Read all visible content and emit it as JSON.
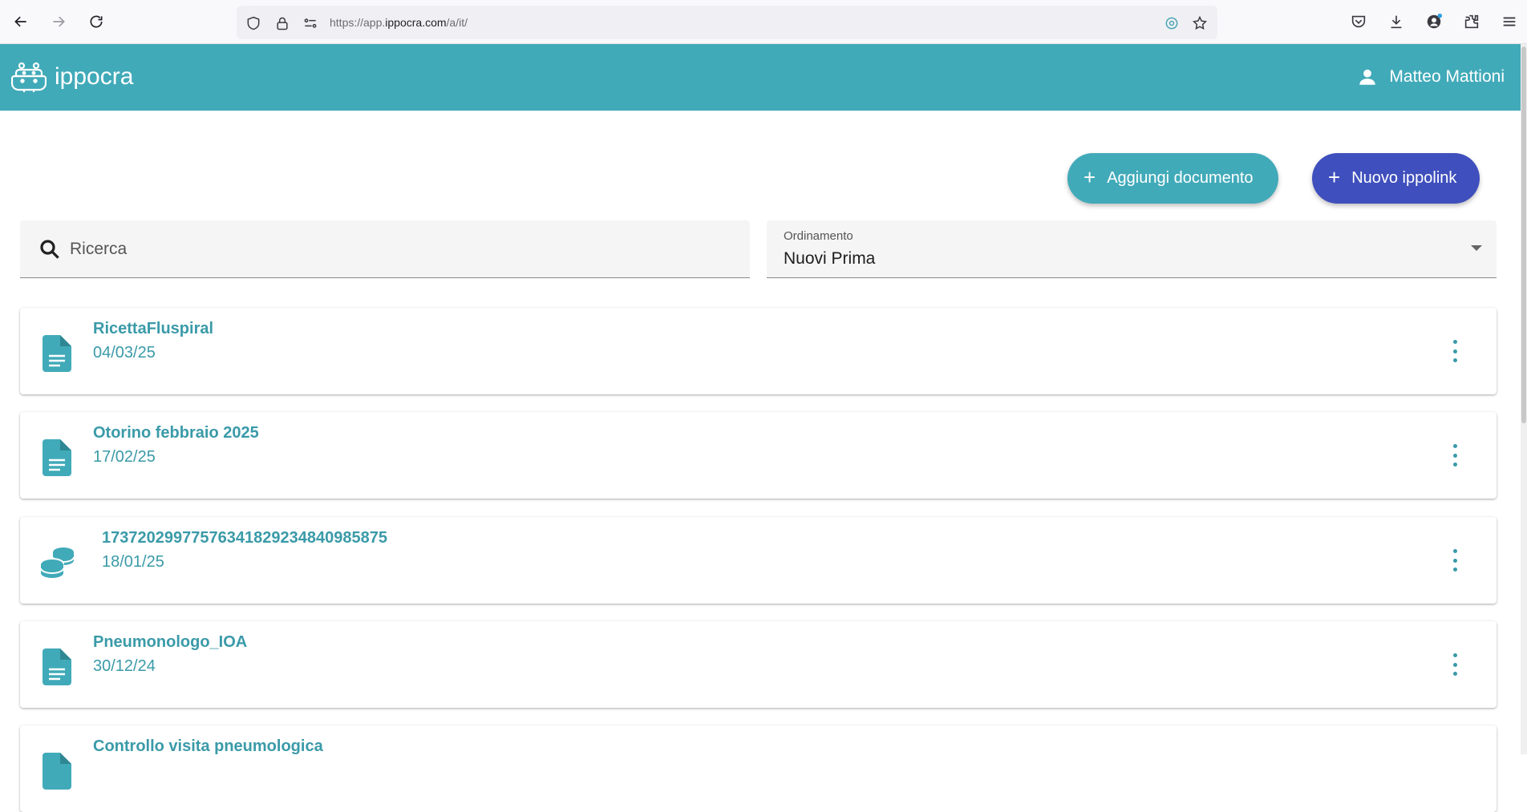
{
  "browser": {
    "url_scheme": "https://app.",
    "url_host": "ippocra.com",
    "url_path": "/a/it/"
  },
  "header": {
    "logo_text": "ippocra",
    "user_name": "Matteo Mattioni",
    "bg_color": "#41aab9"
  },
  "actions": {
    "add_document_label": "Aggiungi documento",
    "new_ippolink_label": "Nuovo ippolink",
    "plus": "+"
  },
  "search": {
    "placeholder": "Ricerca"
  },
  "sort": {
    "label": "Ordinamento",
    "value": "Nuovi Prima"
  },
  "documents": [
    {
      "title": "RicettaFluspiral",
      "date": "04/03/25",
      "icon": "document-icon"
    },
    {
      "title": "Otorino febbraio 2025",
      "date": "17/02/25",
      "icon": "document-icon"
    },
    {
      "title": "1737202997757634182923484098587​5",
      "date": "18/01/25",
      "icon": "coins-icon"
    },
    {
      "title": "Pneumonologo_IOA",
      "date": "30/12/24",
      "icon": "document-icon"
    },
    {
      "title": "Controllo visita pneumologica",
      "date": "",
      "icon": "document-icon"
    }
  ],
  "colors": {
    "accent": "#41aab9",
    "primary_button": "#3f4fbd",
    "link_text": "#3a9aa8"
  }
}
